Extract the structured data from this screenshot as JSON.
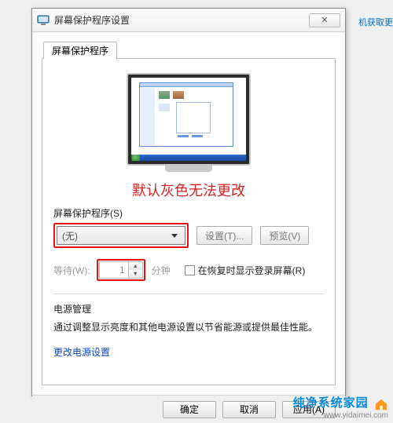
{
  "bg_link": "机获取更",
  "dialog": {
    "title": "屏幕保护程序设置",
    "close_glyph": "✕",
    "tab": "屏幕保护程序",
    "annotation": "默认灰色无法更改",
    "screensaver_label": "屏幕保护程序(S)",
    "combo_value": "(无)",
    "settings_btn": "设置(T)...",
    "preview_btn": "预览(V)",
    "wait_label": "等待(W):",
    "wait_value": "1",
    "wait_unit": "分钟",
    "resume_checkbox": "在恢复时显示登录屏幕(R)",
    "pm_heading": "电源管理",
    "pm_desc": "通过调整显示亮度和其他电源设置以节省能源或提供最佳性能。",
    "pm_link": "更改电源设置",
    "footer": {
      "ok": "确定",
      "cancel": "取消",
      "apply": "应用(A)"
    }
  },
  "watermark": {
    "brand": "纯净系统家园",
    "url": "www.yidaimei.com"
  }
}
